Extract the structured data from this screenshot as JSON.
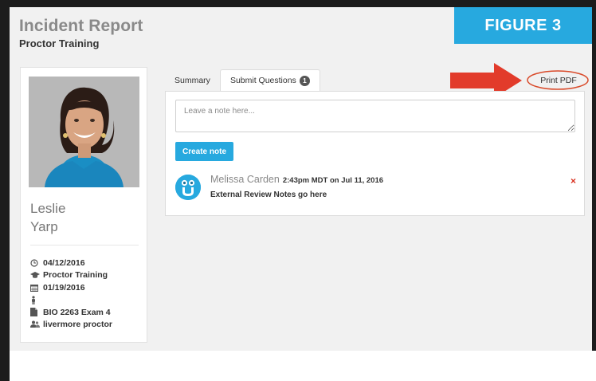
{
  "header": {
    "title": "Incident Report",
    "subtitle": "Proctor Training"
  },
  "figure_label": "FIGURE 3",
  "profile": {
    "first_name": "Leslie",
    "last_name": "Yarp",
    "info": [
      {
        "icon": "clock-icon",
        "text": "04/12/2016"
      },
      {
        "icon": "graduation-cap-icon",
        "text": "Proctor Training"
      },
      {
        "icon": "calendar-icon",
        "text": "01/19/2016"
      },
      {
        "icon": "person-icon",
        "text": ""
      },
      {
        "icon": "file-icon",
        "text": "BIO 2263 Exam 4"
      },
      {
        "icon": "users-icon",
        "text": "livermore proctor"
      }
    ]
  },
  "tabs": {
    "summary": "Summary",
    "submit_questions": "Submit Questions",
    "submit_questions_count": "1"
  },
  "print_pdf_label": "Print PDF",
  "note_form": {
    "placeholder": "Leave a note here...",
    "create_label": "Create note"
  },
  "note": {
    "author": "Melissa Carden",
    "time": "2:43pm MDT on Jul 11, 2016",
    "body": "External Review Notes go here",
    "delete": "×"
  },
  "colors": {
    "accent": "#27a9df",
    "annotation_red": "#e23b2b"
  }
}
